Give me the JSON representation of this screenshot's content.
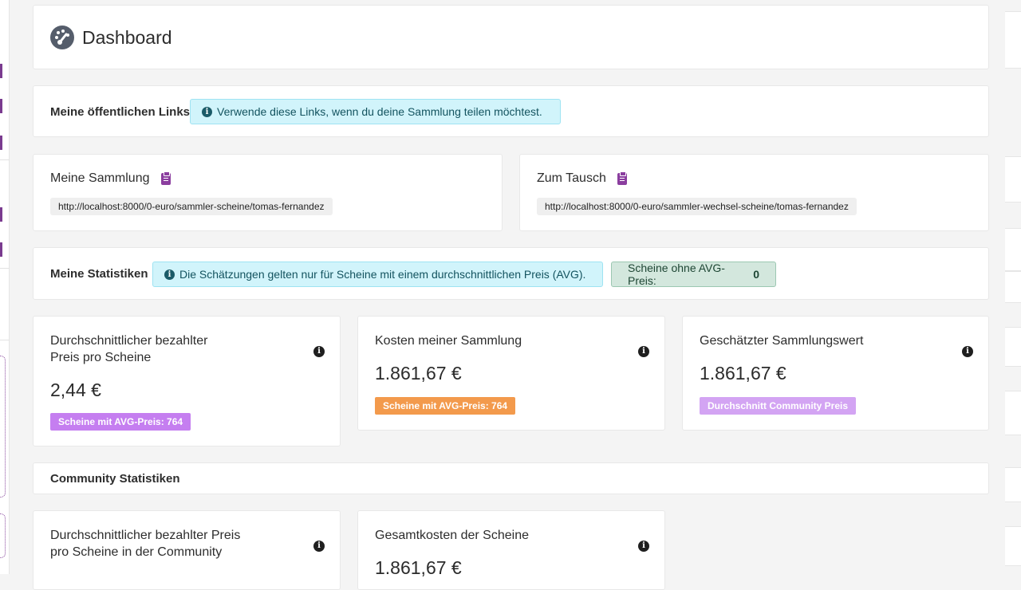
{
  "header": {
    "title": "Dashboard"
  },
  "public_links": {
    "label": "Meine öffentlichen Links",
    "info": "Verwende diese Links, wenn du deine Sammlung teilen möchtest."
  },
  "collection": {
    "title": "Meine Sammlung",
    "url": "http://localhost:8000/0-euro/sammler-scheine/tomas-fernandez"
  },
  "exchange": {
    "title": "Zum Tausch",
    "url": "http://localhost:8000/0-euro/sammler-wechsel-scheine/tomas-fernandez"
  },
  "my_stats": {
    "label": "Meine Statistiken",
    "info": "Die Schätzungen gelten nur für Scheine mit einem durchschnittlichen Preis (AVG).",
    "no_avg_label": "Scheine ohne AVG-Preis:",
    "no_avg_count": "0"
  },
  "stat_cards": [
    {
      "title_line1": "Durchschnittlicher bezahlter",
      "title_line2": "Preis pro Scheine",
      "value": "2,44 €",
      "badge": "Scheine mit AVG-Preis: 764",
      "badge_color": "#c57ef0"
    },
    {
      "title_line1": "Kosten meiner Sammlung",
      "value": "1.861,67 €",
      "badge": "Scheine mit AVG-Preis: 764",
      "badge_color": "#f39a4c"
    },
    {
      "title_line1": "Geschätzter Sammlungswert",
      "value": "1.861,67 €",
      "badge": "Durchschnitt Community Preis",
      "badge_color": "#d3a4f3"
    }
  ],
  "community": {
    "label": "Community Statistiken",
    "cards": [
      {
        "title_line1": "Durchschnittlicher bezahlter Preis",
        "title_line2": "pro Scheine in der Community"
      },
      {
        "title_line1": "Gesamtkosten der Scheine",
        "value": "1.861,67 €"
      }
    ]
  },
  "icons": {
    "dashboard": "gauge-icon",
    "info": "info-circle-icon",
    "clipboard": "clipboard-icon"
  },
  "colors": {
    "accent": "#8b3e9f",
    "info_bg": "#d1f4fb",
    "success_bg": "#d3e7dd"
  }
}
